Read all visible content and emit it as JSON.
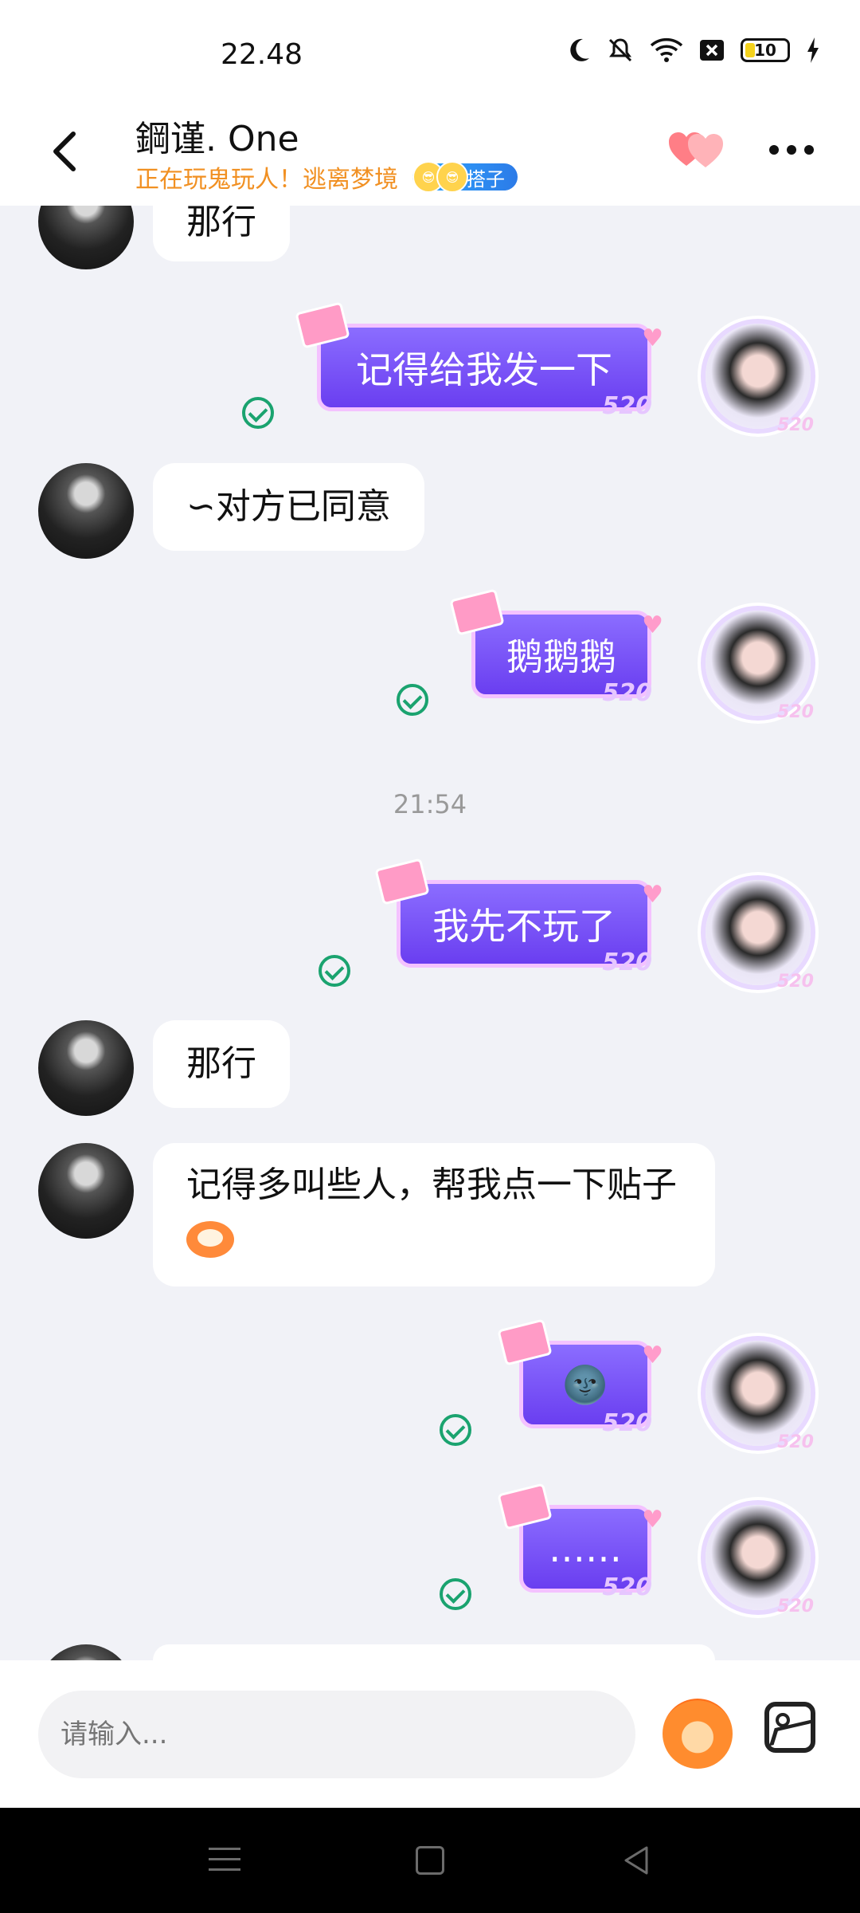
{
  "status_bar": {
    "time": "22.48",
    "battery": "10"
  },
  "header": {
    "title": "鋼谨. One",
    "status": "正在玩鬼玩人！逃离梦境",
    "tag": "搭子"
  },
  "messages": [
    {
      "side": "left",
      "text": "那行"
    },
    {
      "side": "right",
      "text": "记得给我发一下",
      "badge": "520"
    },
    {
      "side": "left",
      "text": "∽对方已同意"
    },
    {
      "side": "right",
      "text": "鹅鹅鹅",
      "badge": "520"
    },
    {
      "type": "time",
      "text": "21:54"
    },
    {
      "side": "right",
      "text": "我先不玩了",
      "badge": "520"
    },
    {
      "side": "left",
      "text": "那行"
    },
    {
      "side": "left",
      "text": "记得多叫些人，帮我点一下贴子"
    },
    {
      "side": "right",
      "text": "🌚",
      "badge": "520"
    },
    {
      "side": "right",
      "text": "……",
      "badge": "520"
    }
  ],
  "input": {
    "placeholder": "请输入..."
  },
  "icons": {
    "back": "back-arrow-icon",
    "hearts": "hearts-icon",
    "more": "more-icon",
    "sticker": "sticker-icon",
    "image": "image-icon"
  }
}
